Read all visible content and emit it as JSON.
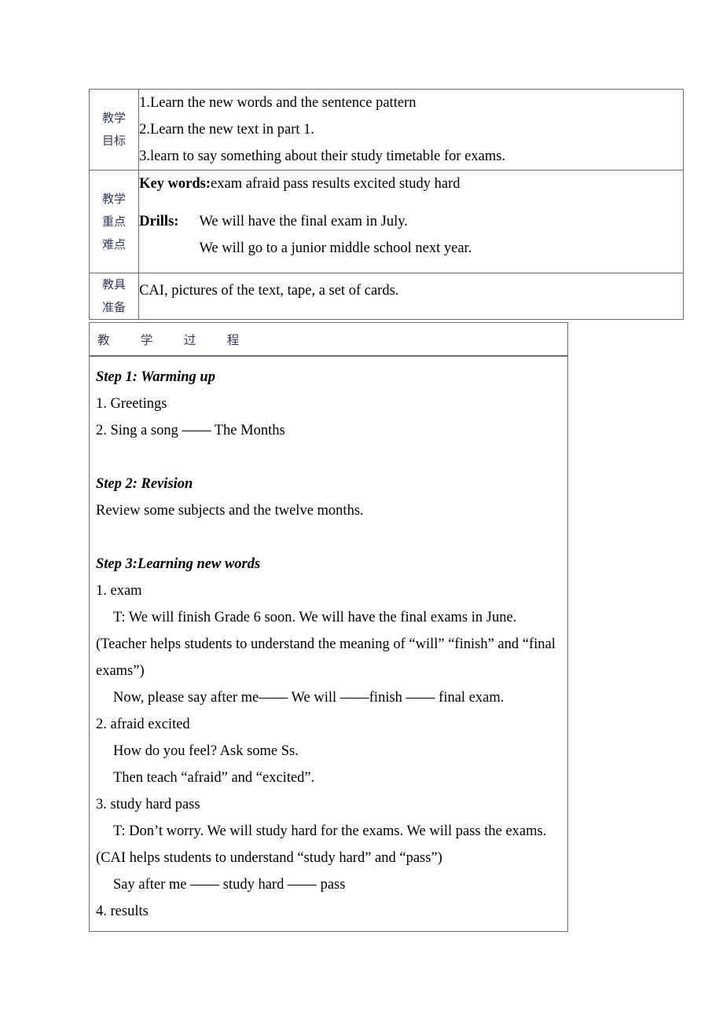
{
  "document": {
    "type": "lesson-plan-table",
    "language_mix": "Chinese labels with English content",
    "text_color": "#000000",
    "label_color": "#353a64",
    "border_color": "#6e6e6e"
  },
  "header_table": {
    "rows": [
      {
        "label_lines": [
          "教学",
          "目标"
        ],
        "label_name": "teaching-objectives",
        "body_lines": [
          "1.Learn the new words and the sentence pattern",
          "2.Learn the new text in part 1.",
          "3.learn to say something about their study timetable for exams."
        ]
      },
      {
        "label_lines": [
          "教学",
          "重点",
          "难点"
        ],
        "label_name": "key-points-difficulties",
        "key_words_label": "Key words:",
        "key_words_value": "exam      afraid      pass      results    excited      study hard",
        "drills_label": "Drills:",
        "drills_lines": [
          "We will have the final exam in July.",
          "We will go to a junior middle school next year."
        ]
      },
      {
        "label_lines": [
          "教具",
          "准备"
        ],
        "label_name": "teaching-aids",
        "body_lines": [
          "CAI, pictures of the text, tape, a set of cards."
        ]
      }
    ]
  },
  "process_header": {
    "title": "教        学        过        程"
  },
  "process_body": {
    "blocks": [
      {
        "kind": "step",
        "text": "Step 1: Warming up"
      },
      {
        "kind": "line",
        "text": "1. Greetings"
      },
      {
        "kind": "line",
        "text": "2. Sing a song  ——  The Months"
      },
      {
        "kind": "blank",
        "text": ""
      },
      {
        "kind": "step",
        "text": "Step 2: Revision"
      },
      {
        "kind": "line",
        "text": "Review some subjects and the twelve months."
      },
      {
        "kind": "blank",
        "text": ""
      },
      {
        "kind": "step",
        "text": "Step 3:Learning new words"
      },
      {
        "kind": "line",
        "text": "1. exam"
      },
      {
        "kind": "indent",
        "text": "T: We will finish Grade 6 soon. We will have the final exams in June."
      },
      {
        "kind": "wrap",
        "text": "(Teacher helps students to understand the meaning of “will” “finish” and “final exams”)"
      },
      {
        "kind": "indent",
        "text": "Now, please say after me——  We will  ——finish  ——  final exam."
      },
      {
        "kind": "line",
        "text": "2. afraid     excited"
      },
      {
        "kind": "indent",
        "text": "How do you feel? Ask some Ss."
      },
      {
        "kind": "indent",
        "text": "Then teach “afraid” and “excited”."
      },
      {
        "kind": "line",
        "text": "3. study hard      pass"
      },
      {
        "kind": "indent",
        "text": "T: Don’t worry. We will study hard for the exams. We will pass the exams."
      },
      {
        "kind": "line",
        "text": "(CAI helps students to understand “study hard” and “pass”)"
      },
      {
        "kind": "indent",
        "text": "Say after me  ——  study hard  ——  pass"
      },
      {
        "kind": "line",
        "text": "4. results"
      }
    ]
  }
}
